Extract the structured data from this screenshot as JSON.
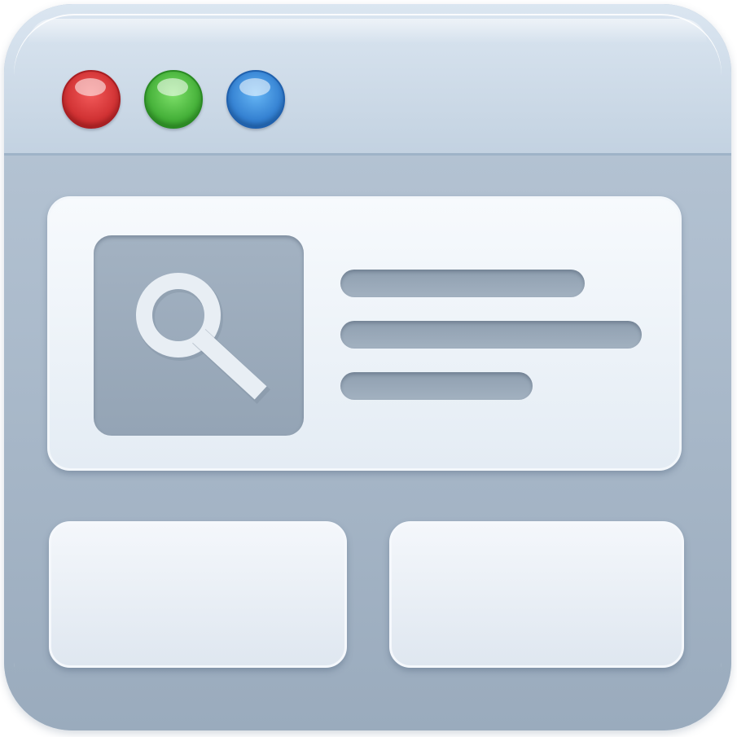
{
  "window": {
    "traffic_lights": [
      {
        "name": "close",
        "color": "#d8312f"
      },
      {
        "name": "minimize",
        "color": "#4cbb3a"
      },
      {
        "name": "maximize",
        "color": "#3a8ee0"
      }
    ]
  },
  "colors": {
    "frame": "#c9d6e3",
    "frame_border": "#a9bcd0",
    "content_background": "#a8b7c7",
    "card": "#eef3f8",
    "thumbnail": "#9cabbb",
    "placeholder_line": "#98a8b8",
    "search_glyph": "#e8eef4"
  },
  "icons": {
    "thumbnail_icon": "search-icon"
  }
}
